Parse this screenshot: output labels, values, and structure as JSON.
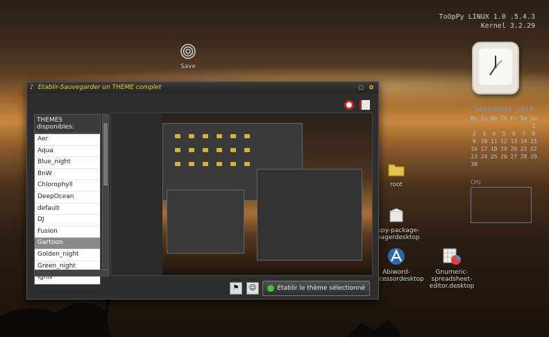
{
  "sysinfo": {
    "line1": "ToOpPy LINUX 1.0 .5.4.3",
    "line2": "Kernel 3.2.29"
  },
  "desktop_icons": {
    "save": "Save",
    "root": "root",
    "package_manager": "uppy-package-\nanagerdesktop",
    "abiword": "Abiword-\nprocessordesktop",
    "gnumeric": "Gnumeric-spreadsheet-\neditor.desktop"
  },
  "calendar": {
    "month": "September 2013",
    "days": [
      "Mo",
      "Tu",
      "We",
      "Th",
      "Fr",
      "Sa",
      "Su"
    ],
    "weeks": [
      [
        "",
        "",
        "",
        "",
        "",
        "",
        "1"
      ],
      [
        "2",
        "3",
        "4",
        "5",
        "6",
        "7",
        "8"
      ],
      [
        "9",
        "10",
        "11",
        "12",
        "13",
        "14",
        "15"
      ],
      [
        "16",
        "17",
        "18",
        "19",
        "20",
        "21",
        "22"
      ],
      [
        "23",
        "24",
        "25",
        "26",
        "27",
        "28",
        "29"
      ],
      [
        "30",
        "",
        "",
        "",
        "",
        "",
        ""
      ]
    ]
  },
  "cpu": {
    "label": "CPU"
  },
  "window": {
    "title": "Etablir-Sauvegarder un THEME complet",
    "themes_header": "THEMES disponibles:",
    "themes": [
      "Aer",
      "Aqua",
      "Blue_night",
      "BnW",
      "Chlorophyll",
      "DeepOcean",
      "default",
      "DJ",
      "Fusion",
      "Gartoon",
      "Golden_night",
      "Green_night",
      "Ignis"
    ],
    "selected_theme": "Gartoon",
    "apply_label": "Etablir le thème sélectionné"
  },
  "colors": {
    "title_accent": "#f0d020",
    "selected_row": "#8a8a8a"
  }
}
